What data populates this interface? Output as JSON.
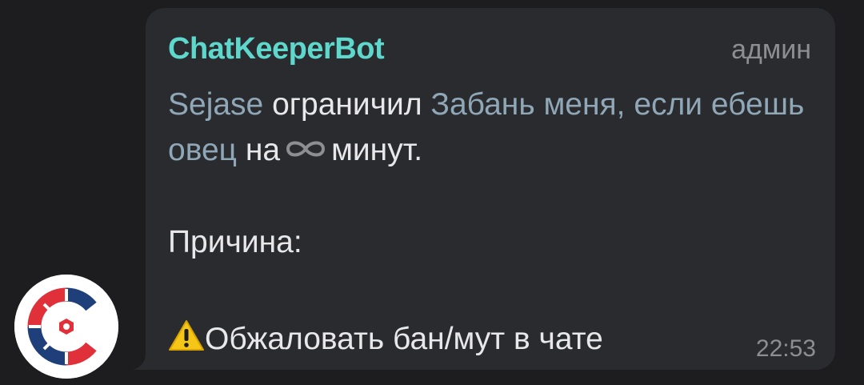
{
  "message": {
    "sender": "ChatKeeperBot",
    "role": "админ",
    "user": "Sejase",
    "action": "ограничил",
    "reason_link": "Забань меня, если ебешь овец",
    "duration_prefix": "на",
    "duration_icon": "infinity-icon",
    "duration_suffix": "минут.",
    "reason_label": "Причина:",
    "appeal_icon": "warning-icon",
    "appeal_text": "Обжаловать бан/мут в чате",
    "time": "22:53"
  },
  "colors": {
    "background": "#1d1d1f",
    "bubble": "#2a2b2f",
    "sender": "#5ed8cc",
    "link": "#8fa7b7",
    "text": "#e8e8ea",
    "meta": "#8d8e92",
    "avatar_red": "#e0313b",
    "avatar_blue": "#1f3f7a"
  },
  "avatar": {
    "icon": "chatkeeper-logo-icon"
  }
}
